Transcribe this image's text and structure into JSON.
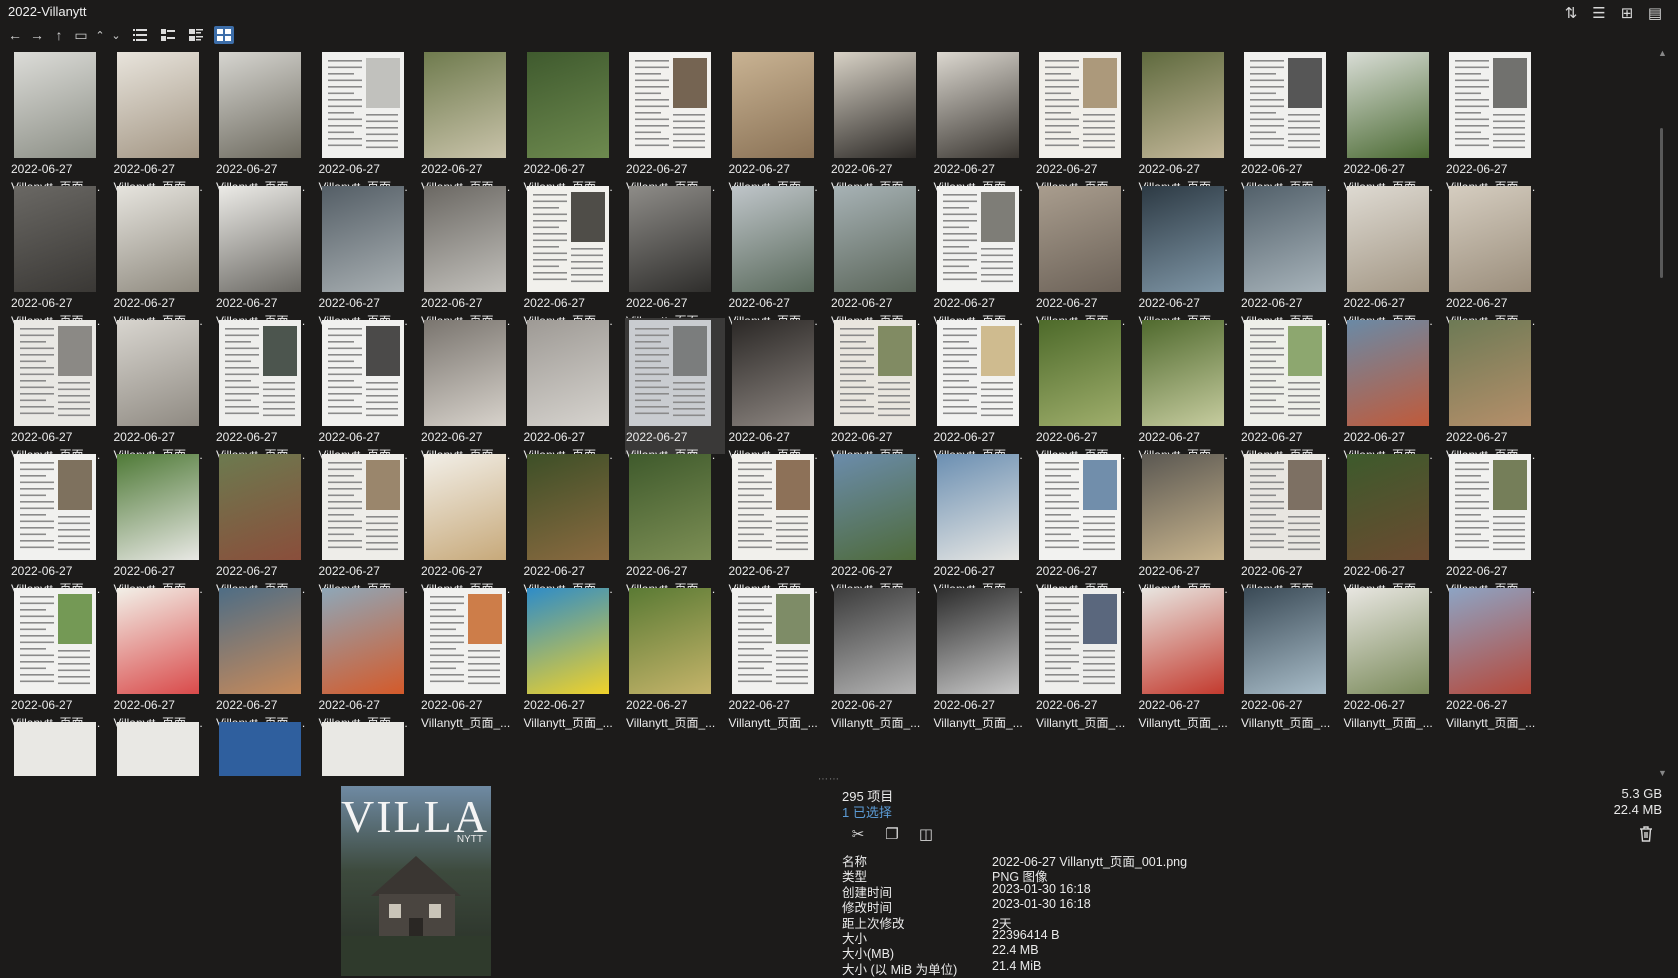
{
  "window": {
    "title": "2022-Villanytt"
  },
  "icons": {
    "sort": "sort-icon",
    "details": "details-view-icon",
    "new_window": "new-window-icon",
    "clipboard": "clipboard-icon",
    "back": "back-arrow-icon",
    "forward": "forward-arrow-icon",
    "up": "up-arrow-icon",
    "folder": "folder-icon",
    "caret_up": "caret-up-icon",
    "caret_down": "caret-down-icon",
    "view_list": "list-view-icon",
    "view_details": "details-list-view-icon",
    "view_tiles": "tiles-view-icon",
    "view_thumbs": "thumbnail-view-icon",
    "cut": "cut-icon",
    "copy": "copy-icon",
    "compare": "compare-icon",
    "trash": "trash-icon"
  },
  "grid": {
    "columns": 15,
    "date_label": "2022-06-27",
    "name_label": "Villanytt_页面_...",
    "selected_index": 36,
    "partial_row_count": 4,
    "rows": [
      [
        {
          "c1": "#dcdcd8",
          "c2": "#8c8f86",
          "type": "photo"
        },
        {
          "c1": "#e8e4dc",
          "c2": "#a39684",
          "type": "photo"
        },
        {
          "c1": "#d6d5d0",
          "c2": "#6d6a5f",
          "type": "photo"
        },
        {
          "c1": "#f0f0ee",
          "c2": "#b8b8b4",
          "type": "text"
        },
        {
          "c1": "#6f7b4e",
          "c2": "#c9c3aa",
          "type": "photo"
        },
        {
          "c1": "#3f5a2e",
          "c2": "#6e8a4f",
          "type": "photo"
        },
        {
          "c1": "#f2f1ee",
          "c2": "#5f4b36",
          "type": "text"
        },
        {
          "c1": "#c9b393",
          "c2": "#8a7256",
          "type": "photo"
        },
        {
          "c1": "#d8d2c6",
          "c2": "#2d2a27",
          "type": "photo"
        },
        {
          "c1": "#dcd8d0",
          "c2": "#3a3631",
          "type": "photo"
        },
        {
          "c1": "#f1efea",
          "c2": "#a08a67",
          "type": "text"
        },
        {
          "c1": "#5f6a3e",
          "c2": "#c4b89a",
          "type": "photo"
        },
        {
          "c1": "#f0f0ee",
          "c2": "#3b3b3b",
          "type": "text"
        },
        {
          "c1": "#d9ddd6",
          "c2": "#4c6b34",
          "type": "photo"
        },
        {
          "c1": "#f1f1ef",
          "c2": "#5a5a57",
          "type": "text"
        }
      ],
      [
        {
          "c1": "#6a6864",
          "c2": "#3a3835",
          "type": "photo"
        },
        {
          "c1": "#e6e4de",
          "c2": "#8f8a7f",
          "type": "photo"
        },
        {
          "c1": "#ecebe7",
          "c2": "#6b6964",
          "type": "photo"
        },
        {
          "c1": "#545e66",
          "c2": "#a8afb2",
          "type": "photo"
        },
        {
          "c1": "#6b6863",
          "c2": "#c2c0bb",
          "type": "photo"
        },
        {
          "c1": "#f1f0ec",
          "c2": "#33302c",
          "type": "text"
        },
        {
          "c1": "#8e8c88",
          "c2": "#2f2e2c",
          "type": "photo"
        },
        {
          "c1": "#bfc5c9",
          "c2": "#5a6a5c",
          "type": "photo"
        },
        {
          "c1": "#a7b2b5",
          "c2": "#5b665a",
          "type": "photo"
        },
        {
          "c1": "#f1f1ef",
          "c2": "#6a6862",
          "type": "text"
        },
        {
          "c1": "#a99d8e",
          "c2": "#6c6258",
          "type": "photo"
        },
        {
          "c1": "#2d3a44",
          "c2": "#7f96a6",
          "type": "photo"
        },
        {
          "c1": "#52606a",
          "c2": "#a7b3ba",
          "type": "photo"
        },
        {
          "c1": "#dedad2",
          "c2": "#a39785",
          "type": "photo"
        },
        {
          "c1": "#d5cdc0",
          "c2": "#9b8e7c",
          "type": "photo"
        }
      ],
      [
        {
          "c1": "#e9e8e4",
          "c2": "#7a7874",
          "type": "text"
        },
        {
          "c1": "#d8d5cf",
          "c2": "#8f8a82",
          "type": "photo"
        },
        {
          "c1": "#eeeeec",
          "c2": "#2f3a33",
          "type": "text"
        },
        {
          "c1": "#f1f1ef",
          "c2": "#2e2d2b",
          "type": "text"
        },
        {
          "c1": "#7a756f",
          "c2": "#d7d2cb",
          "type": "photo"
        },
        {
          "c1": "#9e9a95",
          "c2": "#d6d3ce",
          "type": "photo"
        },
        {
          "c1": "#c9ccd0",
          "c2": "#6d6e6e",
          "type": "text"
        },
        {
          "c1": "#2b2826",
          "c2": "#8c8580",
          "type": "photo"
        },
        {
          "c1": "#e9e6df",
          "c2": "#6e7a4d",
          "type": "text"
        },
        {
          "c1": "#f2f2f0",
          "c2": "#c9b17e",
          "type": "text"
        },
        {
          "c1": "#4d6a2a",
          "c2": "#9fae6c",
          "type": "photo"
        },
        {
          "c1": "#506a2e",
          "c2": "#c6cc9f",
          "type": "photo"
        },
        {
          "c1": "#eeefe9",
          "c2": "#7b9a59",
          "type": "text"
        },
        {
          "c1": "#6a8aa6",
          "c2": "#c05a3a",
          "type": "photo"
        },
        {
          "c1": "#6d7a55",
          "c2": "#b58f6a",
          "type": "photo"
        }
      ],
      [
        {
          "c1": "#f1f1ef",
          "c2": "#6a5a44",
          "type": "text"
        },
        {
          "c1": "#4f7a37",
          "c2": "#e8e8e4",
          "type": "photo"
        },
        {
          "c1": "#6c7a4f",
          "c2": "#8a4e3b",
          "type": "photo"
        },
        {
          "c1": "#eeede9",
          "c2": "#8b7356",
          "type": "text"
        },
        {
          "c1": "#f2efe8",
          "c2": "#c7a97a",
          "type": "photo"
        },
        {
          "c1": "#3d4f27",
          "c2": "#8a6a40",
          "type": "photo"
        },
        {
          "c1": "#3f5a2c",
          "c2": "#7d8f55",
          "type": "photo"
        },
        {
          "c1": "#f1f0ec",
          "c2": "#7b5a3e",
          "type": "text"
        },
        {
          "c1": "#6b8cab",
          "c2": "#4e6a3a",
          "type": "photo"
        },
        {
          "c1": "#6b8fb2",
          "c2": "#e7e7e4",
          "type": "photo"
        },
        {
          "c1": "#f2f2f0",
          "c2": "#5b7d9f",
          "type": "text"
        },
        {
          "c1": "#5b5852",
          "c2": "#c8b48d",
          "type": "photo"
        },
        {
          "c1": "#e8e6e1",
          "c2": "#6a5a4c",
          "type": "text"
        },
        {
          "c1": "#3d5a2c",
          "c2": "#6b4a30",
          "type": "photo"
        },
        {
          "c1": "#f1f1ef",
          "c2": "#5f6a3e",
          "type": "text"
        }
      ],
      [
        {
          "c1": "#f1f1ef",
          "c2": "#5e8a3a",
          "type": "text"
        },
        {
          "c1": "#f2f0e8",
          "c2": "#d94a4a",
          "type": "photo"
        },
        {
          "c1": "#4e6d85",
          "c2": "#c88a5a",
          "type": "photo"
        },
        {
          "c1": "#8ea7b8",
          "c2": "#d45a2a",
          "type": "photo"
        },
        {
          "c1": "#f1f1ef",
          "c2": "#c7682c",
          "type": "text"
        },
        {
          "c1": "#2e8cc8",
          "c2": "#f0d22a",
          "type": "photo"
        },
        {
          "c1": "#5a7a34",
          "c2": "#c5b46a",
          "type": "photo"
        },
        {
          "c1": "#f1f1ef",
          "c2": "#6a7a4f",
          "type": "text"
        },
        {
          "c1": "#3c3c3c",
          "c2": "#b4b4b4",
          "type": "photo"
        },
        {
          "c1": "#2c2c2c",
          "c2": "#c9c9c9",
          "type": "photo"
        },
        {
          "c1": "#eeeeec",
          "c2": "#3f4f6a",
          "type": "text"
        },
        {
          "c1": "#e8e6e1",
          "c2": "#c33a2e",
          "type": "photo"
        },
        {
          "c1": "#3a4a56",
          "c2": "#a8bcc8",
          "type": "photo"
        },
        {
          "c1": "#e8e6e1",
          "c2": "#7a8a5a",
          "type": "photo"
        },
        {
          "c1": "#8da4c4",
          "c2": "#b5483a",
          "type": "photo"
        }
      ]
    ]
  },
  "status": {
    "count_label": "295 项目",
    "selected_label": "1 已选择",
    "total_size": "5.3 GB",
    "selected_size": "22.4 MB"
  },
  "preview": {
    "cover_title": "VILLA",
    "cover_subtitle": "NYTT",
    "colors": {
      "top": "#6f8aa3",
      "mid": "#3d4a3d",
      "bottom": "#262c24"
    }
  },
  "props": [
    {
      "key": "名称",
      "value": "2022-06-27 Villanytt_页面_001.png"
    },
    {
      "key": "类型",
      "value": "PNG 图像"
    },
    {
      "key": "创建时间",
      "value": "2023-01-30  16:18"
    },
    {
      "key": "修改时间",
      "value": "2023-01-30  16:18"
    },
    {
      "key": "距上次修改",
      "value": "2天"
    },
    {
      "key": "大小",
      "value": "22396414 B"
    },
    {
      "key": "大小(MB)",
      "value": "22.4 MB"
    },
    {
      "key": "大小 (以 MiB 为单位)",
      "value": "21.4 MiB"
    }
  ],
  "glyphs": {
    "sort": "⇅",
    "details": "☰",
    "new_window": "⊞",
    "clipboard": "▤",
    "back": "←",
    "forward": "→",
    "up": "↑",
    "folder": "▭",
    "caret_up": "⌃",
    "caret_down": "⌄",
    "cut": "✂",
    "copy": "❐",
    "compare": "◫",
    "trash": "🗑"
  }
}
